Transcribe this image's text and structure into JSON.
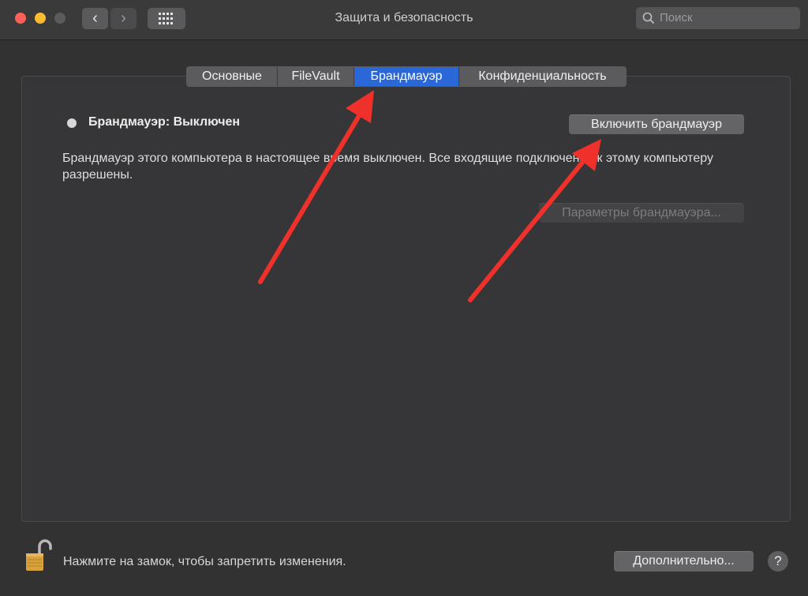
{
  "window": {
    "title": "Защита и безопасность",
    "search_placeholder": "Поиск"
  },
  "tabs": [
    {
      "label": "Основные",
      "selected": false
    },
    {
      "label": "FileVault",
      "selected": false
    },
    {
      "label": "Брандмауэр",
      "selected": true
    },
    {
      "label": "Конфиденциальность",
      "selected": false
    }
  ],
  "firewall": {
    "status_label": "Брандмауэр: Выключен",
    "enable_button": "Включить брандмауэр",
    "description": "Брандмауэр этого компьютера в настоящее время выключен. Все входящие подключения к этому компьютеру разрешены.",
    "options_button": "Параметры брандмауэра..."
  },
  "footer": {
    "lock_text": "Нажмите на замок, чтобы запретить изменения.",
    "advanced_button": "Дополнительно...",
    "help_label": "?"
  },
  "colors": {
    "accent": "#2a67d8",
    "annotation_arrow": "#f0302a"
  },
  "icons": [
    "back-chevron-icon",
    "forward-chevron-icon",
    "grid-icon",
    "search-icon",
    "lock-icon",
    "help-icon"
  ]
}
